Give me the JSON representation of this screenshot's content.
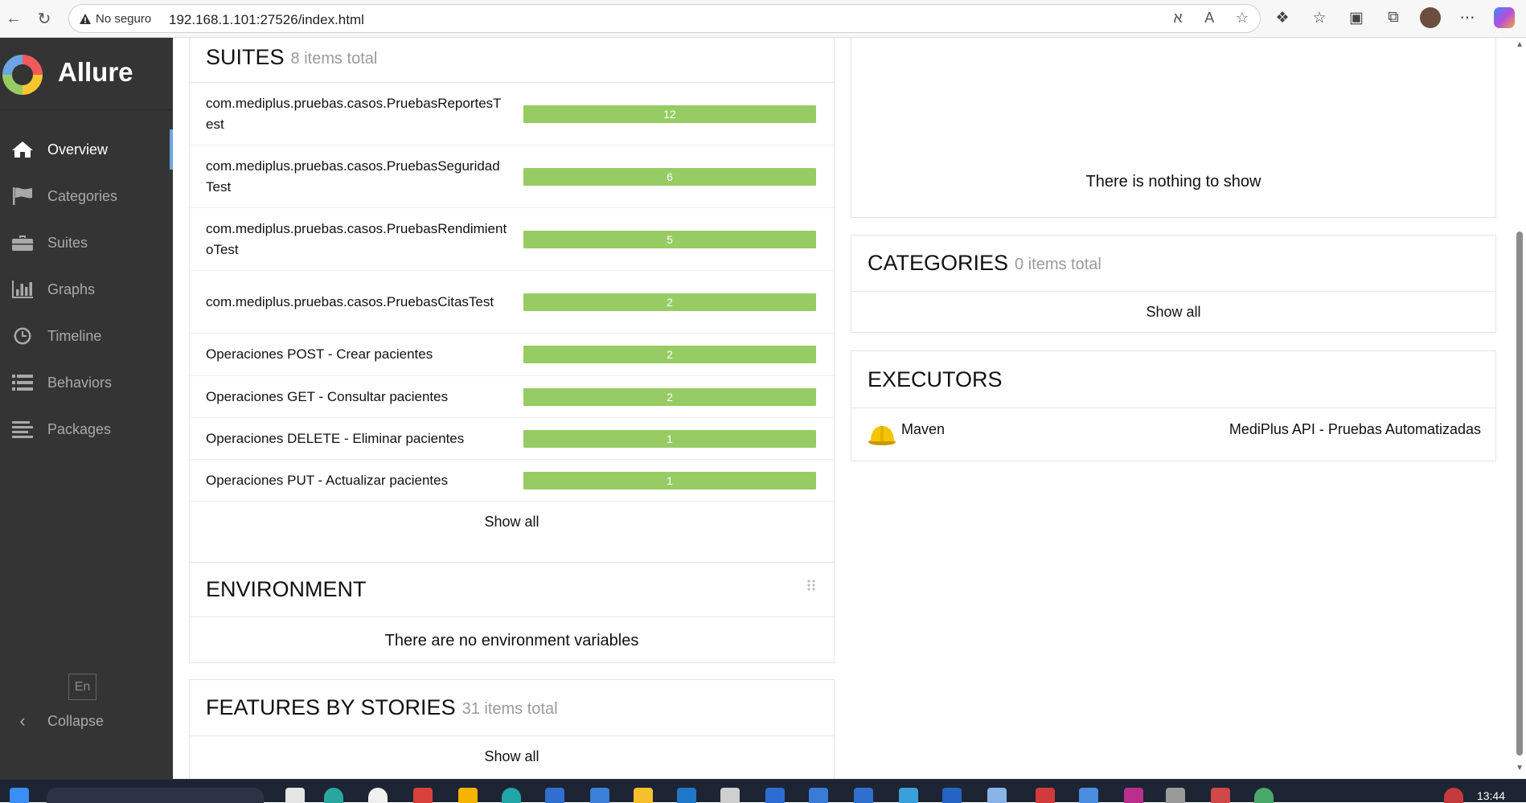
{
  "browser": {
    "security_label": "No seguro",
    "url": "192.168.1.101:27526/index.html"
  },
  "sidebar": {
    "brand": "Allure",
    "items": [
      {
        "label": "Overview",
        "icon": "home-icon",
        "active": true
      },
      {
        "label": "Categories",
        "icon": "flag-icon",
        "active": false
      },
      {
        "label": "Suites",
        "icon": "briefcase-icon",
        "active": false
      },
      {
        "label": "Graphs",
        "icon": "bar-chart-icon",
        "active": false
      },
      {
        "label": "Timeline",
        "icon": "clock-icon",
        "active": false
      },
      {
        "label": "Behaviors",
        "icon": "list-icon",
        "active": false
      },
      {
        "label": "Packages",
        "icon": "align-left-icon",
        "active": false
      }
    ],
    "language": "En",
    "collapse_label": "Collapse"
  },
  "suites": {
    "title": "SUITES",
    "count": "8 items total",
    "rows": [
      {
        "name": "com.mediplus.pruebas.casos.PruebasReportesTest",
        "value": "12"
      },
      {
        "name": "com.mediplus.pruebas.casos.PruebasSeguridadTest",
        "value": "6"
      },
      {
        "name": "com.mediplus.pruebas.casos.PruebasRendimientoTest",
        "value": "5"
      },
      {
        "name": "com.mediplus.pruebas.casos.PruebasCitasTest",
        "value": "2"
      },
      {
        "name": "Operaciones POST - Crear pacientes",
        "value": "2"
      },
      {
        "name": "Operaciones GET - Consultar pacientes",
        "value": "2"
      },
      {
        "name": "Operaciones DELETE - Eliminar pacientes",
        "value": "1"
      },
      {
        "name": "Operaciones PUT - Actualizar pacientes",
        "value": "1"
      }
    ],
    "show_all": "Show all"
  },
  "environment": {
    "title": "ENVIRONMENT",
    "empty_text": "There are no environment variables"
  },
  "features": {
    "title": "FEATURES BY STORIES",
    "count": "31 items total",
    "show_all": "Show all"
  },
  "trend": {
    "empty_text": "There is nothing to show"
  },
  "categories": {
    "title": "CATEGORIES",
    "count": "0 items total",
    "show_all": "Show all"
  },
  "executors": {
    "title": "EXECUTORS",
    "name": "Maven",
    "build": "MediPlus API - Pruebas Automatizadas",
    "icon": "maven-hardhat-icon"
  },
  "taskbar": {
    "time": "13:44"
  },
  "colors": {
    "sidebar": "#343434",
    "passed": "#97cc64",
    "accent": "#6ba5e3"
  }
}
